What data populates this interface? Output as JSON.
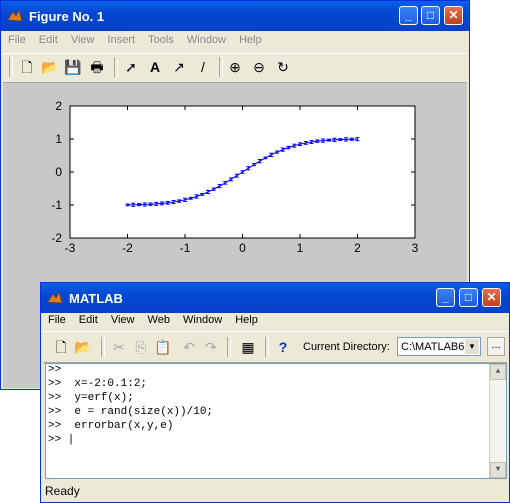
{
  "figure_window": {
    "title": "Figure No. 1",
    "menu": [
      "File",
      "Edit",
      "View",
      "Insert",
      "Tools",
      "Window",
      "Help"
    ],
    "buttons": {
      "minimize": "_",
      "maximize": "□",
      "close": "✕"
    }
  },
  "chart_data": {
    "type": "line",
    "errorbars": true,
    "x": [
      -2.0,
      -1.9,
      -1.8,
      -1.7,
      -1.6,
      -1.5,
      -1.4,
      -1.3,
      -1.2,
      -1.1,
      -1.0,
      -0.9,
      -0.8,
      -0.7,
      -0.6,
      -0.5,
      -0.4,
      -0.3,
      -0.2,
      -0.1,
      0.0,
      0.1,
      0.2,
      0.3,
      0.4,
      0.5,
      0.6,
      0.7,
      0.8,
      0.9,
      1.0,
      1.1,
      1.2,
      1.3,
      1.4,
      1.5,
      1.6,
      1.7,
      1.8,
      1.9,
      2.0
    ],
    "y": [
      -0.995,
      -0.993,
      -0.989,
      -0.984,
      -0.976,
      -0.966,
      -0.952,
      -0.934,
      -0.91,
      -0.88,
      -0.843,
      -0.797,
      -0.742,
      -0.678,
      -0.604,
      -0.52,
      -0.428,
      -0.329,
      -0.223,
      -0.112,
      0.0,
      0.112,
      0.223,
      0.329,
      0.428,
      0.52,
      0.604,
      0.678,
      0.742,
      0.797,
      0.843,
      0.88,
      0.91,
      0.934,
      0.952,
      0.966,
      0.976,
      0.984,
      0.989,
      0.993,
      0.995
    ],
    "xlim": [
      -3,
      3
    ],
    "ylim": [
      -2,
      2
    ],
    "xticks": [
      "-3",
      "-2",
      "-1",
      "0",
      "1",
      "2",
      "3"
    ],
    "yticks": [
      "2",
      "1",
      "0",
      "-1",
      "-2"
    ],
    "color": "#0000ff",
    "error": 0.05,
    "grid": false
  },
  "matlab_window": {
    "title": "MATLAB",
    "menu": [
      "File",
      "Edit",
      "View",
      "Web",
      "Window",
      "Help"
    ],
    "current_directory_label": "Current Directory:",
    "current_directory_value": "C:\\MATLAB6",
    "browse_label": "...",
    "help_label": "?",
    "buttons": {
      "minimize": "_",
      "maximize": "□",
      "close": "✕"
    },
    "command_lines": [
      ">>",
      ">>  x=-2:0.1:2;",
      ">>  y=erf(x);",
      ">>  e = rand(size(x))/10;",
      ">>  errorbar(x,y,e)",
      ">> |"
    ],
    "status": "Ready"
  },
  "colors": {
    "titlebar": "#0548d2",
    "face": "#ece9d8",
    "figure_bg": "#c8c8c8",
    "line": "#0000ff"
  }
}
